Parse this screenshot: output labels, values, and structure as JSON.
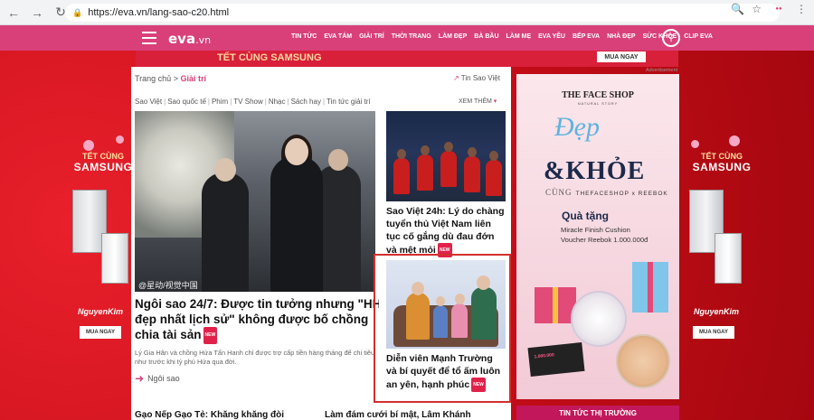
{
  "browser": {
    "url": "https://eva.vn/lang-sao-c20.html"
  },
  "header": {
    "logo": "eva",
    "logo_suffix": ".vn",
    "nav": [
      "TIN TỨC",
      "EVA TÁM",
      "GIẢI TRÍ",
      "THỜI TRANG",
      "LÀM ĐẸP",
      "BÀ BẦU",
      "LÀM MẸ",
      "EVA YÊU",
      "BẾP EVA",
      "NHÀ ĐẸP",
      "SỨC KHỎE",
      "CLIP EVA"
    ]
  },
  "top_banner": {
    "text": "TẾT CÙNG SAMSUNG",
    "button": "MUA NGAY"
  },
  "side_ads": {
    "tet": "TẾT CÙNG",
    "brand": "SAMSUNG",
    "retailer": "NguyenKim",
    "button": "MUA NGAY"
  },
  "breadcrumb": {
    "home": "Trang chủ",
    "sep": ">",
    "current": "Giải trí"
  },
  "trending_link": "Tin Sao Việt",
  "sub_tabs": [
    "Sao Việt",
    "Sao quốc tế",
    "Phim",
    "TV Show",
    "Nhạc",
    "Sách hay",
    "Tin tức giải trí"
  ],
  "more_label": "XEM THÊM",
  "main_article": {
    "watermark": "@星动/视觉中国",
    "title_line1": "Ngôi sao 24/7: Được tin tưởng nhưng \"HH",
    "title_line2": "đẹp nhất lịch sử\" không được bố chồng",
    "title_line3": "chia tài sản",
    "badge": "NEW",
    "summary": "Lý Gia Hân và chồng Hứa Tấn Hanh chỉ được trợ cấp tiền hàng tháng để chi tiêu như trước khi tỷ phú Hứa qua đời.",
    "category": "Ngôi sao"
  },
  "side_articles": [
    {
      "title_line1": "Sao Việt 24h: Lý do chàng",
      "title_line2": "tuyển thủ Việt Nam liên",
      "title_line3": "tục cố gắng dù đau đớn",
      "title_line4": "và mệt mỏi",
      "badge": "NEW"
    },
    {
      "title_line1": "Diễn viên Mạnh Trường",
      "title_line2": "và bí quyết để tổ ấm luôn",
      "title_line3": "an yên, hạnh phúc",
      "badge": "NEW"
    }
  ],
  "bottom_teasers": {
    "left": "Gạo Nếp Gạo Tẻ: Khăng khăng đòi",
    "right": "Làm đám cưới bí mật, Lâm Khánh"
  },
  "ad": {
    "label": "Advertisement",
    "close_icons": [
      "i",
      "x"
    ],
    "brand": "THE FACE SHOP",
    "brand_sub": "NATURAL STORY",
    "headline1": "Đẹp",
    "headline2": "&KHỎE",
    "cung": "CÙNG",
    "partner": "THEFACESHOP x REEBOK",
    "gift": "Quà tặng",
    "offer1": "Miracle Finish Cushion",
    "offer2": "Voucher Reebok 1.000.000đ",
    "voucher_value": "1.000.000"
  },
  "market_bar": "TIN TỨC THỊ TRƯỜNG"
}
